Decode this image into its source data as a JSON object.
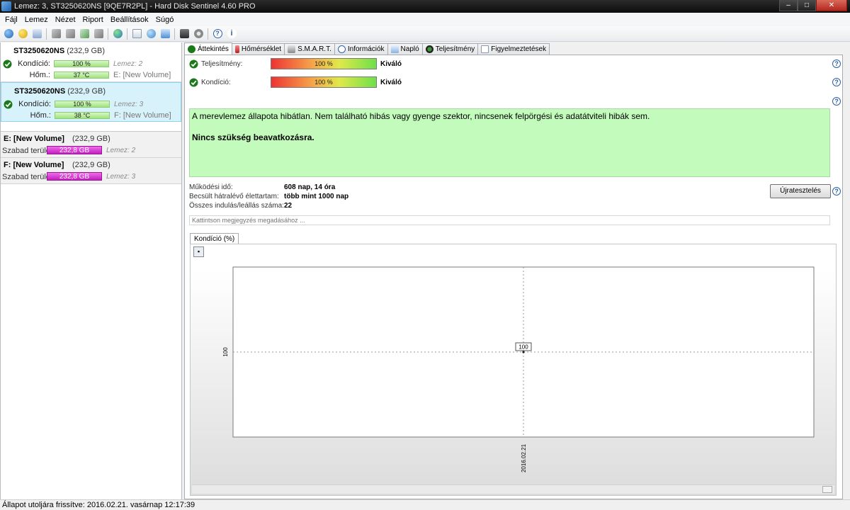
{
  "window": {
    "title": "Lemez: 3, ST3250620NS [9QE7R2PL]  -  Hard Disk Sentinel 4.60 PRO",
    "controls": [
      "–",
      "□",
      "✕"
    ]
  },
  "menu": [
    "Fájl",
    "Lemez",
    "Nézet",
    "Riport",
    "Beállítások",
    "Súgó"
  ],
  "disks": [
    {
      "name": "ST3250620NS",
      "size": "(232,9 GB)",
      "condition_label": "Kondíció:",
      "condition_value": "100 %",
      "condition_pct": 100,
      "disk_note": "Lemez: 2",
      "temp_label": "Hőm.:",
      "temp_value": "37 °C",
      "volume": "E: [New Volume]"
    },
    {
      "name": "ST3250620NS",
      "size": "(232,9 GB)",
      "condition_label": "Kondíció:",
      "condition_value": "100 %",
      "condition_pct": 100,
      "disk_note": "Lemez: 3",
      "temp_label": "Hőm.:",
      "temp_value": "38 °C",
      "volume": "F: [New Volume]"
    }
  ],
  "volumes": [
    {
      "name": "E: [New Volume]",
      "size": "(232,9 GB)",
      "free_label": "Szabad terület",
      "free_value": "232,8 GB",
      "disk": "Lemez: 2"
    },
    {
      "name": "F: [New Volume]",
      "size": "(232,9 GB)",
      "free_label": "Szabad terület",
      "free_value": "232,8 GB",
      "disk": "Lemez: 3"
    }
  ],
  "tabs": [
    "Áttekintés",
    "Hőmérséklet",
    "S.M.A.R.T.",
    "Információk",
    "Napló",
    "Teljesítmény",
    "Figyelmeztetések"
  ],
  "overview": {
    "performance_label": "Teljesítmény:",
    "performance_value": "100 %",
    "performance_pct": 100,
    "performance_rating": "Kiváló",
    "condition_label": "Kondíció:",
    "condition_value": "100 %",
    "condition_pct": 100,
    "condition_rating": "Kiváló",
    "message": "A merevlemez állapota hibátlan. Nem található hibás vagy gyenge szektor, nincsenek felpörgési és adatátviteli hibák sem.",
    "advice": "Nincs szükség beavatkozásra.",
    "uptime_label": "Működési idő:",
    "uptime_value": "608 nap, 14 óra",
    "remaining_label": "Becsült hátralévő élettartam:",
    "remaining_value": "több mint 1000 nap",
    "starts_label": "Összes indulás/leállás száma:",
    "starts_value": "22",
    "retest_button": "Újratesztelés",
    "note_placeholder": "Kattintson megjegyzés megadásához ...",
    "help_glyph": "?"
  },
  "chart_tab": "Kondíció  (%)",
  "chart_data": {
    "type": "line",
    "x": [
      "2016.02.21"
    ],
    "series": [
      {
        "values": [
          100
        ]
      }
    ],
    "ylabel": "",
    "xlabel": "",
    "y_tick_labels": [
      "100"
    ],
    "data_labels": [
      "100"
    ],
    "grid": true
  },
  "status": "Állapot utoljára frissítve: 2016.02.21. vasárnap 12:17:39",
  "colors": {
    "accent_green": "#c3fbbc",
    "bar_magenta": "#c21ec0",
    "selected_blue": "#d8f2fb"
  }
}
